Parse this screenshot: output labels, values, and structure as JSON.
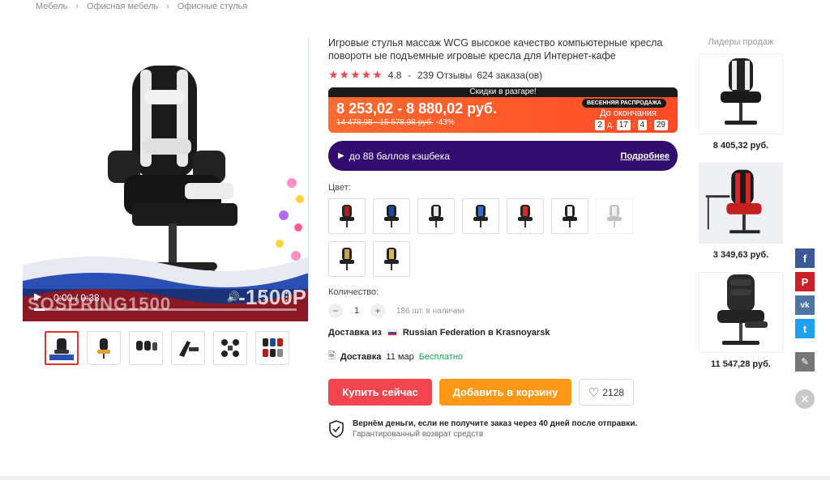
{
  "breadcrumb": [
    "Мебель",
    "Офисная мебель",
    "Офисные стулья"
  ],
  "product": {
    "title": "Игровые стулья массаж WCG высокое качество компьютерные кресла поворотн ые подъемные игровые кресла для Интернет-кафе",
    "rating": "4.8",
    "reviews": "239 Отзывы",
    "orders": "624 заказа(ов)"
  },
  "video": {
    "timecode": "0:00 / 0:38",
    "promo_left": "SOSPRING1500",
    "promo_right": "-1500Р",
    "progress": 0.04
  },
  "sale": {
    "banner": "Скидки в разгаре!",
    "price": "8 253,02 - 8 880,02 руб.",
    "old_price": "14 478,98 - 15 578,98 руб.",
    "discount": "-43%",
    "badge": "ВЕСЕННЯЯ РАСПРОДАЖА",
    "ends_label": "До окончания",
    "timer": {
      "days": "2",
      "days_label": "д.",
      "hours": "17",
      "minutes": "4",
      "seconds": "29"
    }
  },
  "cashback": {
    "text": "до 88 баллов кэшбека",
    "more": "Подробнее"
  },
  "color_label": "Цвет:",
  "quantity": {
    "label": "Количество:",
    "value": "1",
    "stock": "186 шт. в наличии"
  },
  "shipping": {
    "prefix": "Доставка из",
    "location": "Russian Federation в Krasnoyarsk"
  },
  "delivery": {
    "label": "Доставка",
    "date": "11 мар",
    "cost": "Бесплатно"
  },
  "buttons": {
    "buy": "Купить сейчас",
    "cart": "Добавить в корзину",
    "favorites": "2128"
  },
  "guarantee": {
    "title": "Вернём деньги, если не получите заказ через 40 дней после отправки.",
    "sub": "Гарантированный возврат средств"
  },
  "sidebar": {
    "title": "Лидеры продаж",
    "items": [
      {
        "price": "8 405,32 руб."
      },
      {
        "price": "3 349,63 руб."
      },
      {
        "price": "11 547,28 руб."
      }
    ]
  },
  "colors": {
    "accent_red": "#f4444d",
    "accent_orange": "#ff9817",
    "cashback_bg": "#320c6e",
    "sale_bg": "#ff5a2a"
  }
}
